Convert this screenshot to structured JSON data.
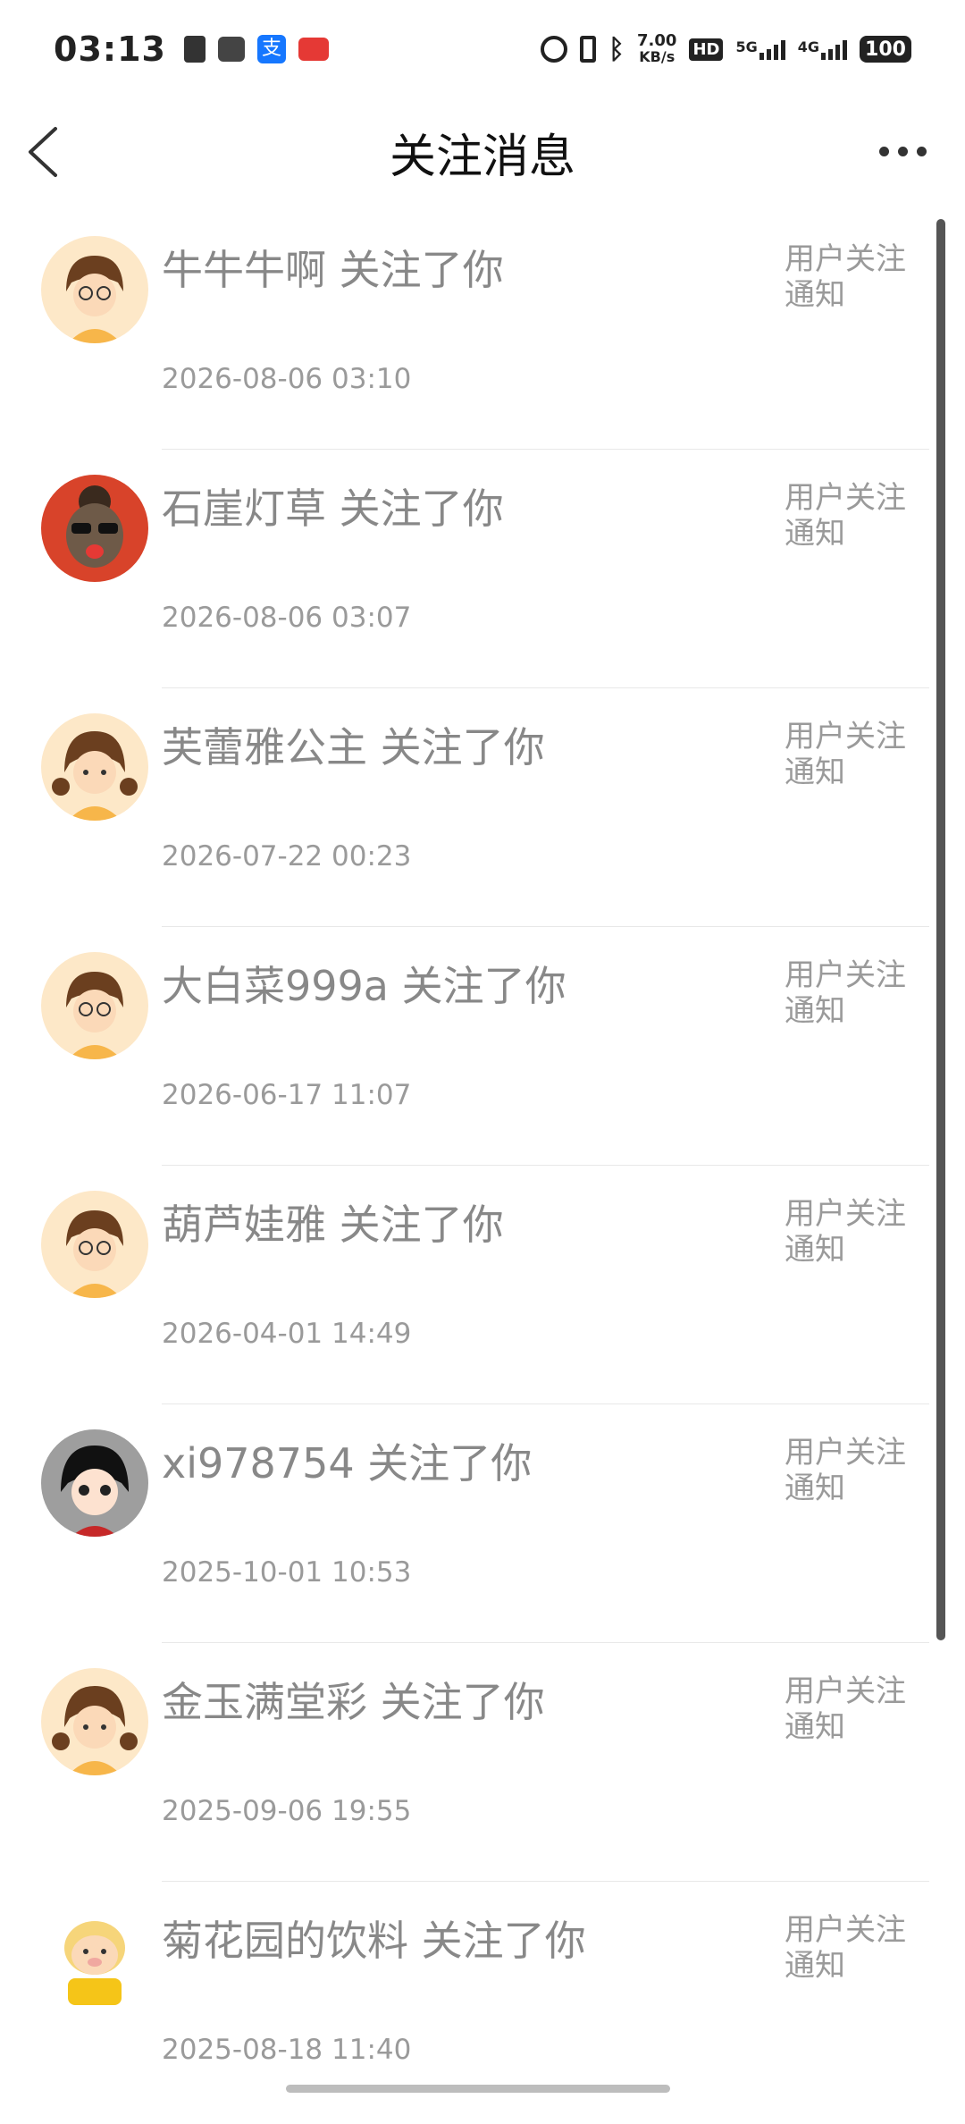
{
  "status_bar": {
    "time": "03:13",
    "net_speed_value": "7.00",
    "net_speed_unit": "KB/s",
    "hd": "HD",
    "sig1_label": "5G",
    "sig2_label": "4G",
    "battery": "100"
  },
  "header": {
    "title": "关注消息"
  },
  "messages": [
    {
      "name": "牛牛牛啊 关注了你",
      "type": "用户关注通知",
      "date": "2026-08-06 03:10"
    },
    {
      "name": "石崖灯草 关注了你",
      "type": "用户关注通知",
      "date": "2026-08-06 03:07"
    },
    {
      "name": "芙蕾雅公主 关注了你",
      "type": "用户关注通知",
      "date": "2026-07-22 00:23"
    },
    {
      "name": "大白菜999a 关注了你",
      "type": "用户关注通知",
      "date": "2026-06-17 11:07"
    },
    {
      "name": "葫芦娃雅 关注了你",
      "type": "用户关注通知",
      "date": "2026-04-01 14:49"
    },
    {
      "name": "xi978754 关注了你",
      "type": "用户关注通知",
      "date": "2025-10-01 10:53"
    },
    {
      "name": "金玉满堂彩 关注了你",
      "type": "用户关注通知",
      "date": "2025-09-06 19:55"
    },
    {
      "name": "菊花园的饮料 关注了你",
      "type": "用户关注通知",
      "date": "2025-08-18 11:40"
    }
  ]
}
